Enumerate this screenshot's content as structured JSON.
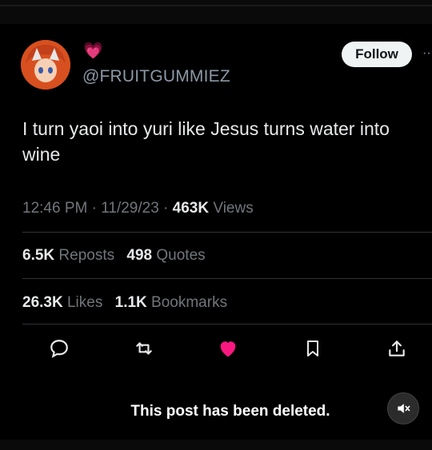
{
  "author": {
    "emoji": "💗",
    "handle": "@FRUITGUMMIEZ"
  },
  "follow_label": "Follow",
  "tweet": {
    "text": "I turn yaoi into yuri like Jesus turns water into wine",
    "time": "12:46 PM",
    "date": "11/29/23",
    "views_count": "463K",
    "views_label": "Views"
  },
  "stats": {
    "reposts_count": "6.5K",
    "reposts_label": "Reposts",
    "quotes_count": "498",
    "quotes_label": "Quotes",
    "likes_count": "26.3K",
    "likes_label": "Likes",
    "bookmarks_count": "1.1K",
    "bookmarks_label": "Bookmarks"
  },
  "actions": [
    "reply-icon",
    "repost-icon",
    "like-icon",
    "bookmark-icon",
    "share-icon"
  ],
  "colors": {
    "like": "#f91880",
    "muted": "#71767b",
    "text": "#e7e9ea"
  },
  "overlay": {
    "deleted_message": "This post has been deleted."
  }
}
